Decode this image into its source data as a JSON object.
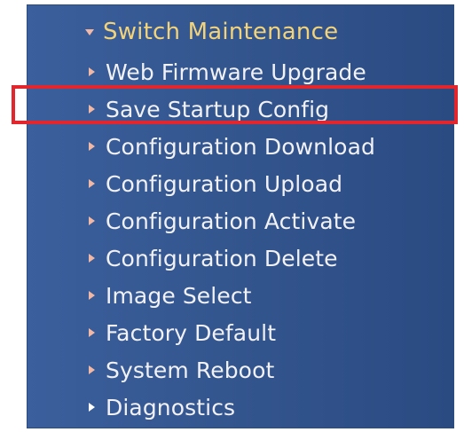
{
  "menu": {
    "title": "Switch Maintenance",
    "title_icon": "expand-arrow-icon",
    "items": [
      {
        "label": "Web Firmware Upgrade",
        "icon": "bullet-arrow-icon"
      },
      {
        "label": "Save Startup Config",
        "icon": "bullet-arrow-icon",
        "highlighted": true
      },
      {
        "label": "Configuration Download",
        "icon": "bullet-arrow-icon"
      },
      {
        "label": "Configuration Upload",
        "icon": "bullet-arrow-icon"
      },
      {
        "label": "Configuration Activate",
        "icon": "bullet-arrow-icon"
      },
      {
        "label": "Configuration Delete",
        "icon": "bullet-arrow-icon"
      },
      {
        "label": "Image Select",
        "icon": "bullet-arrow-icon"
      },
      {
        "label": "Factory Default",
        "icon": "bullet-arrow-icon"
      },
      {
        "label": "System Reboot",
        "icon": "bullet-arrow-icon"
      },
      {
        "label": "Diagnostics",
        "icon": "bullet-arrow-icon"
      }
    ]
  },
  "colors": {
    "panel_background": "#34568f",
    "title_text": "#f2d37a",
    "item_text": "#f1f1f6",
    "bullet": "#f2b8a6",
    "highlight_border": "#e3262e"
  }
}
